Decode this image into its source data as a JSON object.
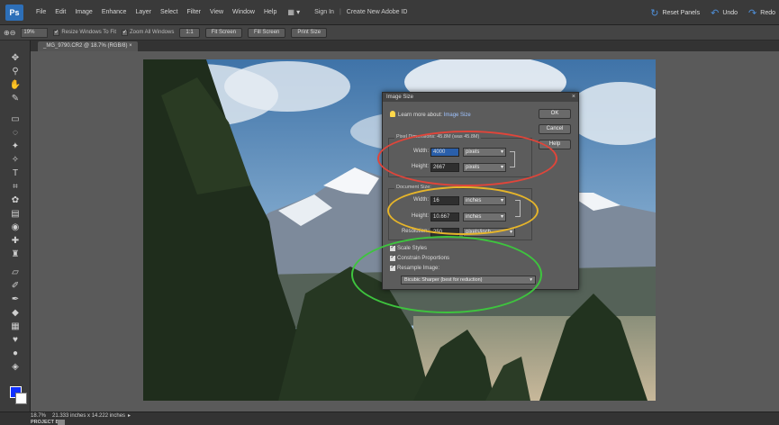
{
  "menubar": {
    "logo": "Ps",
    "items": [
      "File",
      "Edit",
      "Image",
      "Enhance",
      "Layer",
      "Select",
      "Filter",
      "View",
      "Window",
      "Help"
    ],
    "workspace_icon": "▦ ▾",
    "sign_in": "Sign In",
    "separator": "|",
    "create_id": "Create New Adobe ID",
    "reset_panels": "Reset Panels",
    "undo": "Undo",
    "redo": "Redo"
  },
  "options_bar": {
    "zoom_value": "19%",
    "resize_windows": "Resize Windows To Fit",
    "zoom_all_windows": "Zoom All Windows",
    "btn_1to1": "1:1",
    "fit_screen": "Fit Screen",
    "fill_screen": "Fill Screen",
    "print_size": "Print Size"
  },
  "doc_tab": {
    "label": "_MG_9790.CR2 @ 18.7% (RGB/8) ×"
  },
  "dialog": {
    "title": "Image Size",
    "learn_text": "Learn more about:",
    "learn_link": "Image Size",
    "ok": "OK",
    "cancel": "Cancel",
    "help": "Help",
    "pixel_dimensions_title": "Pixel Dimensions: 45.8M (was 45.8M)",
    "width_label": "Width:",
    "width_value": "4000",
    "width_unit": "pixels",
    "height_label": "Height:",
    "height_value": "2667",
    "height_unit": "pixels",
    "document_size_title": "Document Size:",
    "doc_width_label": "Width:",
    "doc_width_value": "16",
    "doc_width_unit": "inches",
    "doc_height_label": "Height:",
    "doc_height_value": "10.667",
    "doc_height_unit": "inches",
    "resolution_label": "Resolution:",
    "resolution_value": "250",
    "resolution_unit": "pixels/inch",
    "scale_styles": "Scale Styles",
    "constrain_proportions": "Constrain Proportions",
    "resample_image": "Resample Image:",
    "resample_method": "Bicubic Sharper (best for reduction)",
    "arrow": "▾"
  },
  "status_bar": {
    "zoom_pct": "18.7%",
    "doc_size": "21.333 inches x 14.222 inches",
    "arrow": "▸",
    "project_bin": "PROJECT BIN"
  },
  "colors": {
    "ring_red": "#e0453a",
    "ring_yellow": "#e6b52a",
    "ring_green": "#3ec43e",
    "foreground": "#1030ff",
    "background": "#ffffff"
  }
}
